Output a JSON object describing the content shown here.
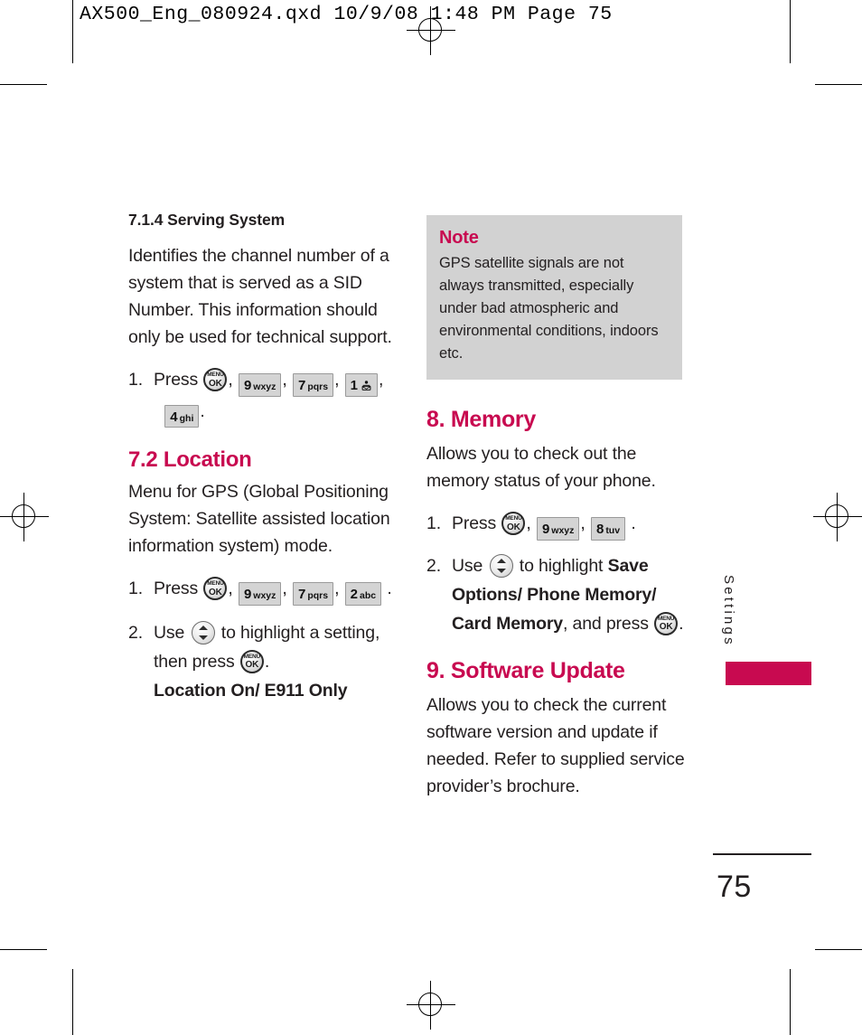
{
  "slug": "AX500_Eng_080924.qxd  10/9/08  1:48 PM  Page 75",
  "colors": {
    "accent": "#c80a50",
    "text": "#231f20",
    "note_bg": "#d2d2d2",
    "key_bg": "#d4d4d4"
  },
  "left_column": {
    "section_714": {
      "heading": "7.1.4 Serving System",
      "body": "Identifies the channel number of a system that is served as a SID Number. This information should only be used for technical support.",
      "step1": {
        "num": "1.",
        "label": "Press",
        "keys": [
          "MENU/OK",
          "9 wxyz",
          "7 pqrs",
          "1 voicemail",
          "4 ghi"
        ],
        "trailing": "."
      }
    },
    "section_72": {
      "heading": "7.2 Location",
      "body": "Menu for GPS (Global Positioning System: Satellite assisted location information system) mode.",
      "step1": {
        "num": "1.",
        "label": "Press",
        "keys": [
          "MENU/OK",
          "9 wxyz",
          "7 pqrs",
          "2 abc"
        ],
        "trailing": "."
      },
      "step2": {
        "num": "2.",
        "label_before": "Use",
        "label_middle": "to highlight a setting, then press",
        "trailing": ".",
        "options": "Location On/ E911  Only"
      }
    }
  },
  "right_column": {
    "note": {
      "title": "Note",
      "body": "GPS satellite signals are not always transmitted, especially under bad atmospheric and environmental conditions, indoors etc."
    },
    "section_8": {
      "heading": "8. Memory",
      "body": "Allows you to check out the memory status of your phone.",
      "step1": {
        "num": "1.",
        "label": "Press",
        "keys": [
          "MENU/OK",
          "9 wxyz",
          "8 tuv"
        ],
        "trailing": "."
      },
      "step2": {
        "num": "2.",
        "label_before": "Use",
        "label_middle": "to highlight",
        "bold_options": "Save Options/ Phone Memory/ Card Memory",
        "label_after": ", and press",
        "trailing": "."
      }
    },
    "section_9": {
      "heading": "9. Software Update",
      "body": "Allows you to check the current software version and update if needed. Refer to supplied service provider’s brochure."
    }
  },
  "side_tab": {
    "label": "Settings"
  },
  "folio": {
    "page_number": "75"
  },
  "keycaps": {
    "menu_ok_top": "MENU",
    "menu_ok_bottom": "OK",
    "k9_digit": "9",
    "k9_letters": "wxyz",
    "k7_digit": "7",
    "k7_letters": "pqrs",
    "k1_digit": "1",
    "k4_digit": "4",
    "k4_letters": "ghi",
    "k2_digit": "2",
    "k2_letters": "abc",
    "k8_digit": "8",
    "k8_letters": "tuv"
  }
}
